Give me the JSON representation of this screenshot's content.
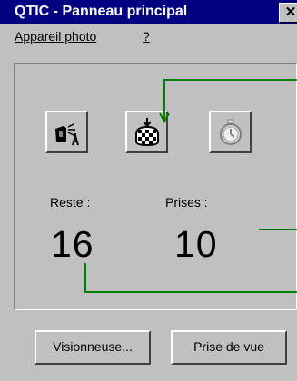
{
  "window": {
    "title": "QTIC - Panneau principal",
    "close_glyph": "✕"
  },
  "menu": {
    "camera": "Appareil photo",
    "help": "?"
  },
  "toolbar": {
    "camera_icon": "camera-settings-icon",
    "shutter_icon": "shutter-release-icon",
    "timer_icon": "self-timer-icon"
  },
  "counters": {
    "remaining_label": "Reste :",
    "remaining_value": "16",
    "taken_label": "Prises :",
    "taken_value": "10"
  },
  "buttons": {
    "viewer": "Visionneuse...",
    "capture": "Prise de vue"
  },
  "colors": {
    "titlebar": "#000080",
    "face": "#c0c0c0",
    "callout": "#008000"
  }
}
